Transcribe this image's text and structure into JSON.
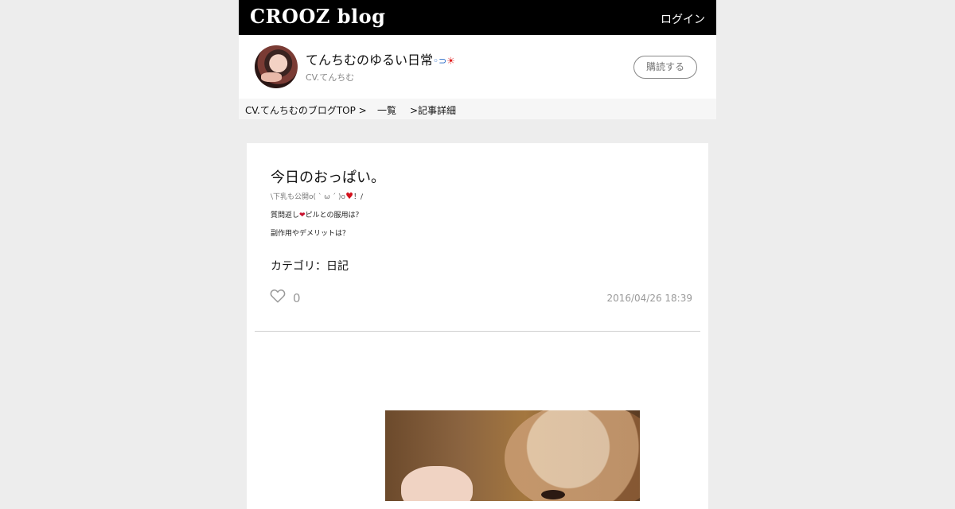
{
  "header": {
    "logo_main": "CROOZ",
    "logo_sub": "blog",
    "login_label": "ログイン"
  },
  "profile": {
    "blog_title": "てんちむのゆるい日常",
    "author": "CV.てんちむ",
    "subscribe_label": "購読する"
  },
  "breadcrumb": {
    "top": "CV.てんちむのブログTOP >",
    "list": "一覧",
    "detail": ">記事詳細"
  },
  "article": {
    "title": "今日のおっぱい。",
    "line1_a": "\\下乳も公開o( ˋ ω ˊ )o",
    "line1_b": "！/",
    "line2_a": "質問返し",
    "line2_b": "ピルとの服用は？",
    "line3": "副作用やデメリットは？",
    "category": "カテゴリ：日記",
    "like_count": "0",
    "date": "2016/04/26 18:39"
  },
  "icons": {
    "heart": "heart-outline-icon",
    "accent_red": "#d4101c"
  }
}
